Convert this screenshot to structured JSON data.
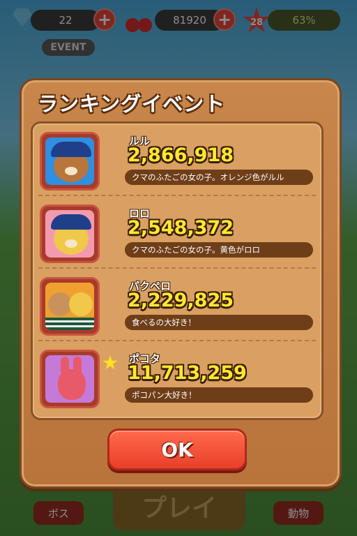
{
  "hud": {
    "gems": "22",
    "cherries": "81920",
    "level": "28",
    "progress_percent": "63%",
    "progress_fraction": 0.63,
    "event_label": "EVENT"
  },
  "bottom_bar": {
    "boss_label": "ボス",
    "play_label": "プレイ",
    "animal_label": "動物"
  },
  "modal": {
    "title": "ランキングイベント",
    "ok_label": "OK",
    "entries": [
      {
        "name": "ルル",
        "score": "2,866,918",
        "desc": "クマのふたごの女の子。オレンジ色がルル",
        "avatar": "bear-blue-sailor",
        "starred": false
      },
      {
        "name": "ロロ",
        "score": "2,548,372",
        "desc": "クマのふたごの女の子。黄色がロロ",
        "avatar": "bear-yellow-sailor",
        "starred": false
      },
      {
        "name": "パクペロ",
        "score": "2,229,825",
        "desc": "食べるの大好き！",
        "avatar": "twin-bears",
        "starred": false
      },
      {
        "name": "ポコタ",
        "score": "11,713,259",
        "desc": "ポコパン大好き！",
        "avatar": "pink-rabbit",
        "starred": true
      }
    ]
  },
  "colors": {
    "score": "#ffe830",
    "ok_button": "#e8402a",
    "panel": "#d9a062"
  }
}
